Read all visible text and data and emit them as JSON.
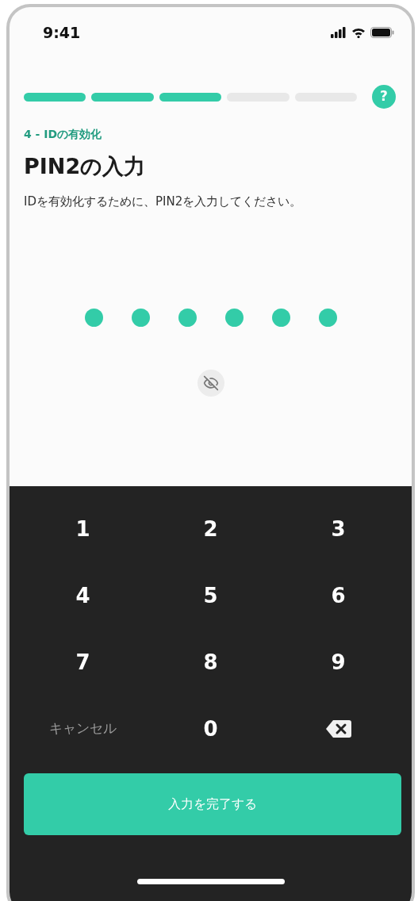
{
  "status_bar": {
    "time": "9:41"
  },
  "progress": {
    "steps": [
      {
        "filled": true
      },
      {
        "filled": true
      },
      {
        "filled": true
      },
      {
        "filled": false
      },
      {
        "filled": false
      }
    ],
    "help": "?"
  },
  "step_label": "4 - IDの有効化",
  "title": "PIN2の入力",
  "description": "IDを有効化するために、PIN2を入力してください。",
  "pin": {
    "dots": [
      {
        "filled": true
      },
      {
        "filled": true
      },
      {
        "filled": true
      },
      {
        "filled": true
      },
      {
        "filled": true
      },
      {
        "filled": true
      }
    ]
  },
  "keypad": {
    "keys": [
      {
        "kind": "digit",
        "label": "1"
      },
      {
        "kind": "digit",
        "label": "2"
      },
      {
        "kind": "digit",
        "label": "3"
      },
      {
        "kind": "digit",
        "label": "4"
      },
      {
        "kind": "digit",
        "label": "5"
      },
      {
        "kind": "digit",
        "label": "6"
      },
      {
        "kind": "digit",
        "label": "7"
      },
      {
        "kind": "digit",
        "label": "8"
      },
      {
        "kind": "digit",
        "label": "9"
      },
      {
        "kind": "cancel",
        "label": "キャンセル"
      },
      {
        "kind": "digit",
        "label": "0"
      },
      {
        "kind": "backspace"
      }
    ]
  },
  "submit_button": "入力を完了する"
}
